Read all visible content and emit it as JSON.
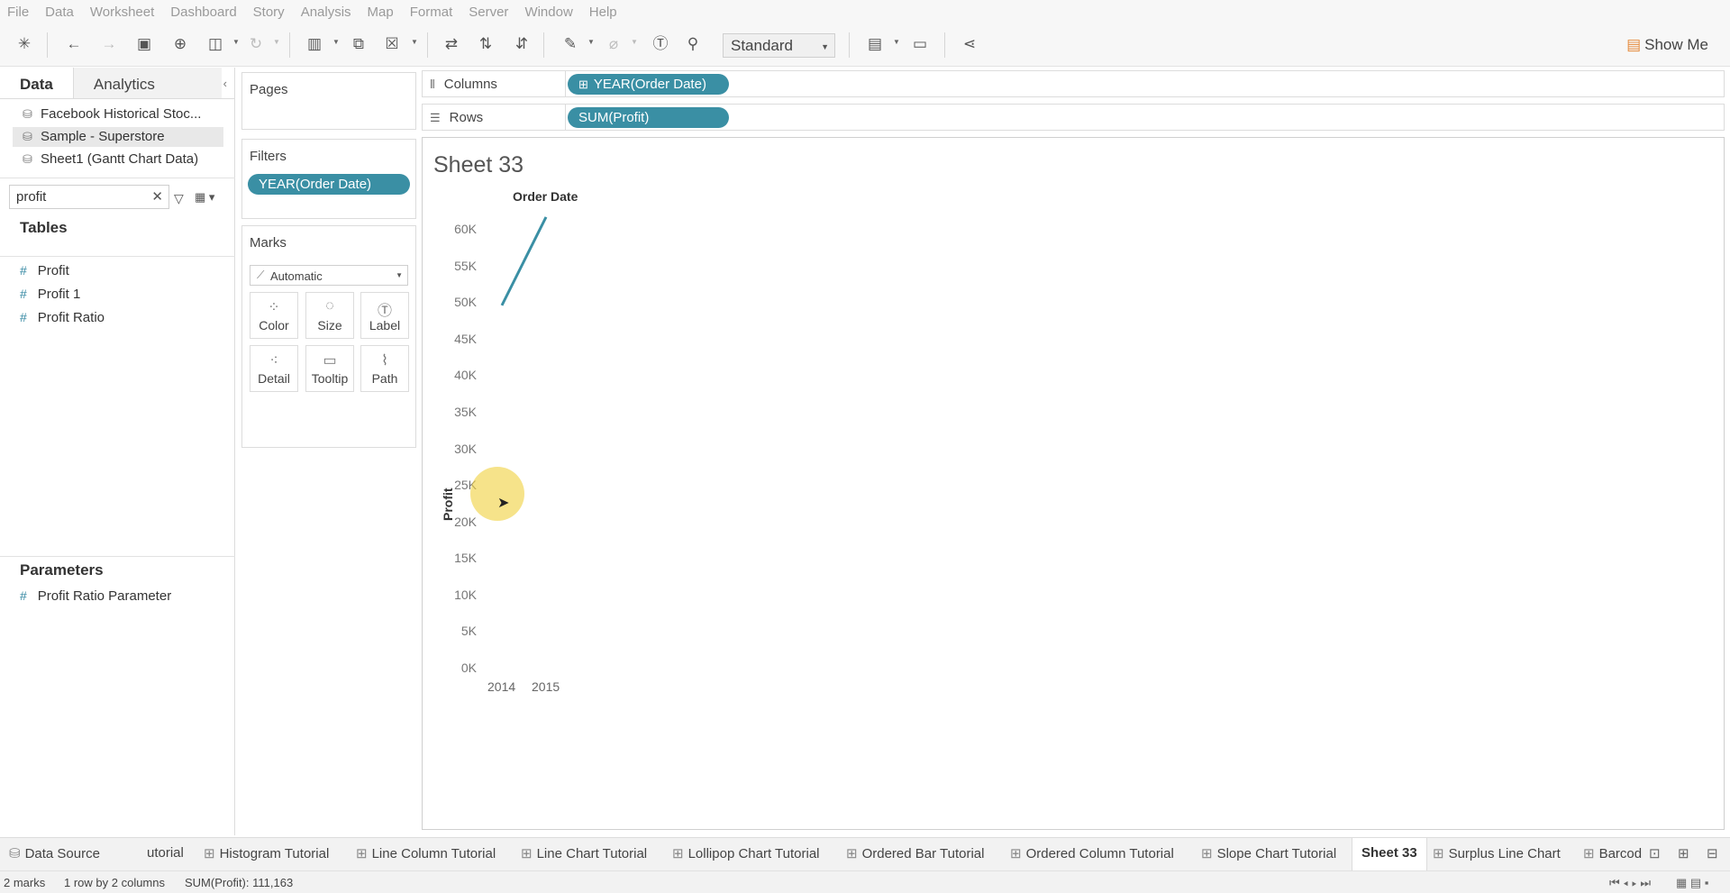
{
  "menu": [
    "File",
    "Data",
    "Worksheet",
    "Dashboard",
    "Story",
    "Analysis",
    "Map",
    "Format",
    "Server",
    "Window",
    "Help"
  ],
  "toolbar": {
    "fit_mode": "Standard",
    "show_me": "Show Me"
  },
  "left_pane": {
    "tab_data": "Data",
    "tab_analytics": "Analytics",
    "data_sources": [
      {
        "name": "Facebook Historical Stoc..."
      },
      {
        "name": "Sample - Superstore"
      },
      {
        "name": "Sheet1 (Gantt Chart Data)"
      }
    ],
    "search_value": "profit",
    "tables_heading": "Tables",
    "fields": [
      {
        "name": "Profit"
      },
      {
        "name": "Profit 1"
      },
      {
        "name": "Profit Ratio"
      }
    ],
    "parameters_heading": "Parameters",
    "parameters": [
      {
        "name": "Profit Ratio Parameter"
      }
    ]
  },
  "pages_card": {
    "label": "Pages"
  },
  "filters_card": {
    "label": "Filters",
    "pill": "YEAR(Order Date)"
  },
  "marks_card": {
    "label": "Marks",
    "mark_type": "Automatic",
    "buttons": [
      "Color",
      "Size",
      "Label",
      "Detail",
      "Tooltip",
      "Path"
    ]
  },
  "columns_shelf": {
    "label": "Columns",
    "pill": "YEAR(Order Date)"
  },
  "rows_shelf": {
    "label": "Rows",
    "pill": "SUM(Profit)"
  },
  "view": {
    "sheet_title": "Sheet 33",
    "header": "Order Date"
  },
  "chart_data": {
    "type": "line",
    "x": [
      "2014",
      "2015"
    ],
    "series": [
      {
        "values": [
          49544,
          61619
        ]
      }
    ],
    "ylabel": "Profit",
    "xlabel": "Order Date",
    "ylim": [
      0,
      62500
    ],
    "y_ticks": [
      "0K",
      "5K",
      "10K",
      "15K",
      "20K",
      "25K",
      "30K",
      "35K",
      "40K",
      "45K",
      "50K",
      "55K",
      "60K"
    ],
    "line_color": "#3a8fa4"
  },
  "sheet_tabs": {
    "data_source": "Data Source",
    "tabs": [
      "utorial",
      "Histogram Tutorial",
      "Line Column Tutorial",
      "Line Chart Tutorial",
      "Lollipop Chart Tutorial",
      "Ordered Bar Tutorial",
      "Ordered Column Tutorial",
      "Slope Chart Tutorial",
      "Sheet 33",
      "Surplus Line Chart",
      "Barcod"
    ],
    "active": "Sheet 33"
  },
  "status": {
    "marks": "2 marks",
    "dims": "1 row by 2 columns",
    "sum": "SUM(Profit): 111,163"
  }
}
